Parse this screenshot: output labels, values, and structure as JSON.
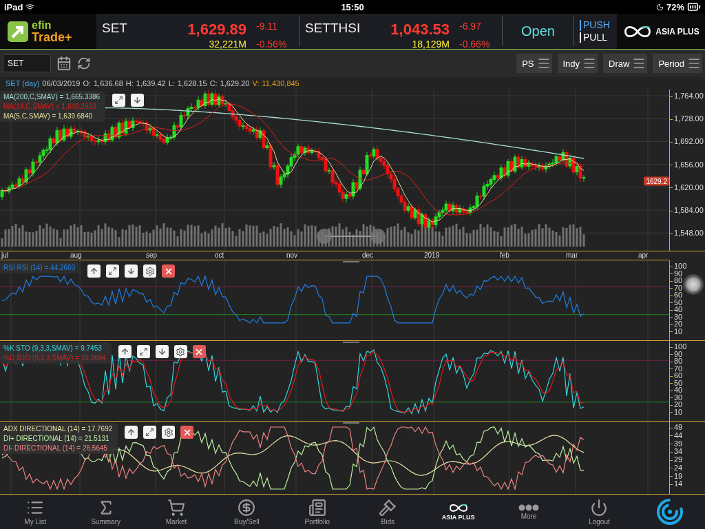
{
  "status_bar": {
    "device": "iPad",
    "time": "15:50",
    "battery": "72%"
  },
  "logo": {
    "line1": "efin",
    "line2": "Trade+"
  },
  "quotes": [
    {
      "symbol": "SET",
      "price": "1,629.89",
      "change": "-9.11",
      "volume": "32,221M",
      "percent": "-0.56%"
    },
    {
      "symbol": "SETTHSI",
      "price": "1,043.53",
      "change": "-6.97",
      "volume": "18,129M",
      "percent": "-0.66%"
    }
  ],
  "market_status": "Open",
  "push_pull": [
    {
      "label": "PUSH",
      "selected": true
    },
    {
      "label": "PULL",
      "selected": false
    }
  ],
  "broker": "ASIA PLUS",
  "toolbar": {
    "symbol": "SET",
    "buttons": [
      "PS",
      "Indy",
      "Draw",
      "Period"
    ]
  },
  "info": {
    "title": "SET (day)",
    "date": "06/03/2019",
    "fields": [
      {
        "label": "O:",
        "value": "1,636.68"
      },
      {
        "label": "H:",
        "value": "1,639.42"
      },
      {
        "label": "L:",
        "value": "1,628.15"
      },
      {
        "label": "C:",
        "value": "1,629.20"
      }
    ],
    "volume_label": "V:",
    "volume": "11,430,845"
  },
  "main_chart": {
    "legend": [
      {
        "label": "MA(200,C,SMAV) = 1,665.3386",
        "color": "#a8ded6"
      },
      {
        "label": "MA(14,C,SMAV) = 1,648.2993",
        "color": "#e01c1c"
      },
      {
        "label": "MA(5,C,SMAV) = 1,639.6840",
        "color": "#e6dfa0"
      }
    ],
    "controls": [
      {
        "kind": "expand"
      },
      {
        "kind": "down"
      }
    ],
    "y_ticks": [
      "1,764.00",
      "1,728.00",
      "1,692.00",
      "1,656.00",
      "1,620.00",
      "1,584.00",
      "1,548.00"
    ],
    "price_tag": "1629.2"
  },
  "x_labels": [
    "jul",
    "aug",
    "sep",
    "oct",
    "nov",
    "dec",
    "2019",
    "feb",
    "mar",
    "apr"
  ],
  "indicators": [
    {
      "kind": "rsi",
      "legend": [
        {
          "label": "RSI RSI (14) = 44.2660",
          "color": "#1f7fe6"
        }
      ],
      "controls": [
        {
          "kind": "up"
        },
        {
          "kind": "expand"
        },
        {
          "kind": "down"
        },
        {
          "kind": "gear"
        },
        {
          "kind": "close"
        }
      ],
      "y_ticks": [
        "100",
        "90",
        "80",
        "70",
        "60",
        "50",
        "40",
        "30",
        "20",
        "10"
      ]
    },
    {
      "kind": "sto",
      "legend": [
        {
          "label": "%K STO (9,3,3,SMAV) = 9.7453",
          "color": "#33d8e0"
        },
        {
          "label": "%D STO (9,3,3,SMAV) = 15.3694",
          "color": "#e01c1c"
        }
      ],
      "controls": [
        {
          "kind": "up"
        },
        {
          "kind": "expand"
        },
        {
          "kind": "down"
        },
        {
          "kind": "gear"
        },
        {
          "kind": "close"
        }
      ],
      "y_ticks": [
        "100",
        "90",
        "80",
        "70",
        "60",
        "50",
        "40",
        "30",
        "20",
        "10"
      ]
    },
    {
      "kind": "adx",
      "legend": [
        {
          "label": "ADX DIRECTIONAL (14) = 17.7692",
          "color": "#ece4a8"
        },
        {
          "label": "DI+ DIRECTIONAL (14) = 21.5131",
          "color": "#bdf0a4"
        },
        {
          "label": "DI- DIRECTIONAL (14) = 26.5645",
          "color": "#f08484"
        }
      ],
      "controls": [
        {
          "kind": "up"
        },
        {
          "kind": "expand"
        },
        {
          "kind": "gear"
        },
        {
          "kind": "close"
        }
      ],
      "y_ticks": [
        "49",
        "44",
        "39",
        "34",
        "29",
        "24",
        "19",
        "14"
      ]
    }
  ],
  "tabs": [
    {
      "kind": "list",
      "label": "My List"
    },
    {
      "kind": "sigma",
      "label": "Summary"
    },
    {
      "kind": "cart",
      "label": "Market"
    },
    {
      "kind": "trade",
      "label": "Buy/Sell"
    },
    {
      "kind": "paper",
      "label": "Portfolio"
    },
    {
      "kind": "gavel",
      "label": "Bids"
    },
    {
      "kind": "brand",
      "label": "ASIA PLUS"
    },
    {
      "kind": "dots",
      "label": "More"
    },
    {
      "kind": "power",
      "label": "Logout"
    },
    {
      "kind": "assist"
    }
  ]
}
